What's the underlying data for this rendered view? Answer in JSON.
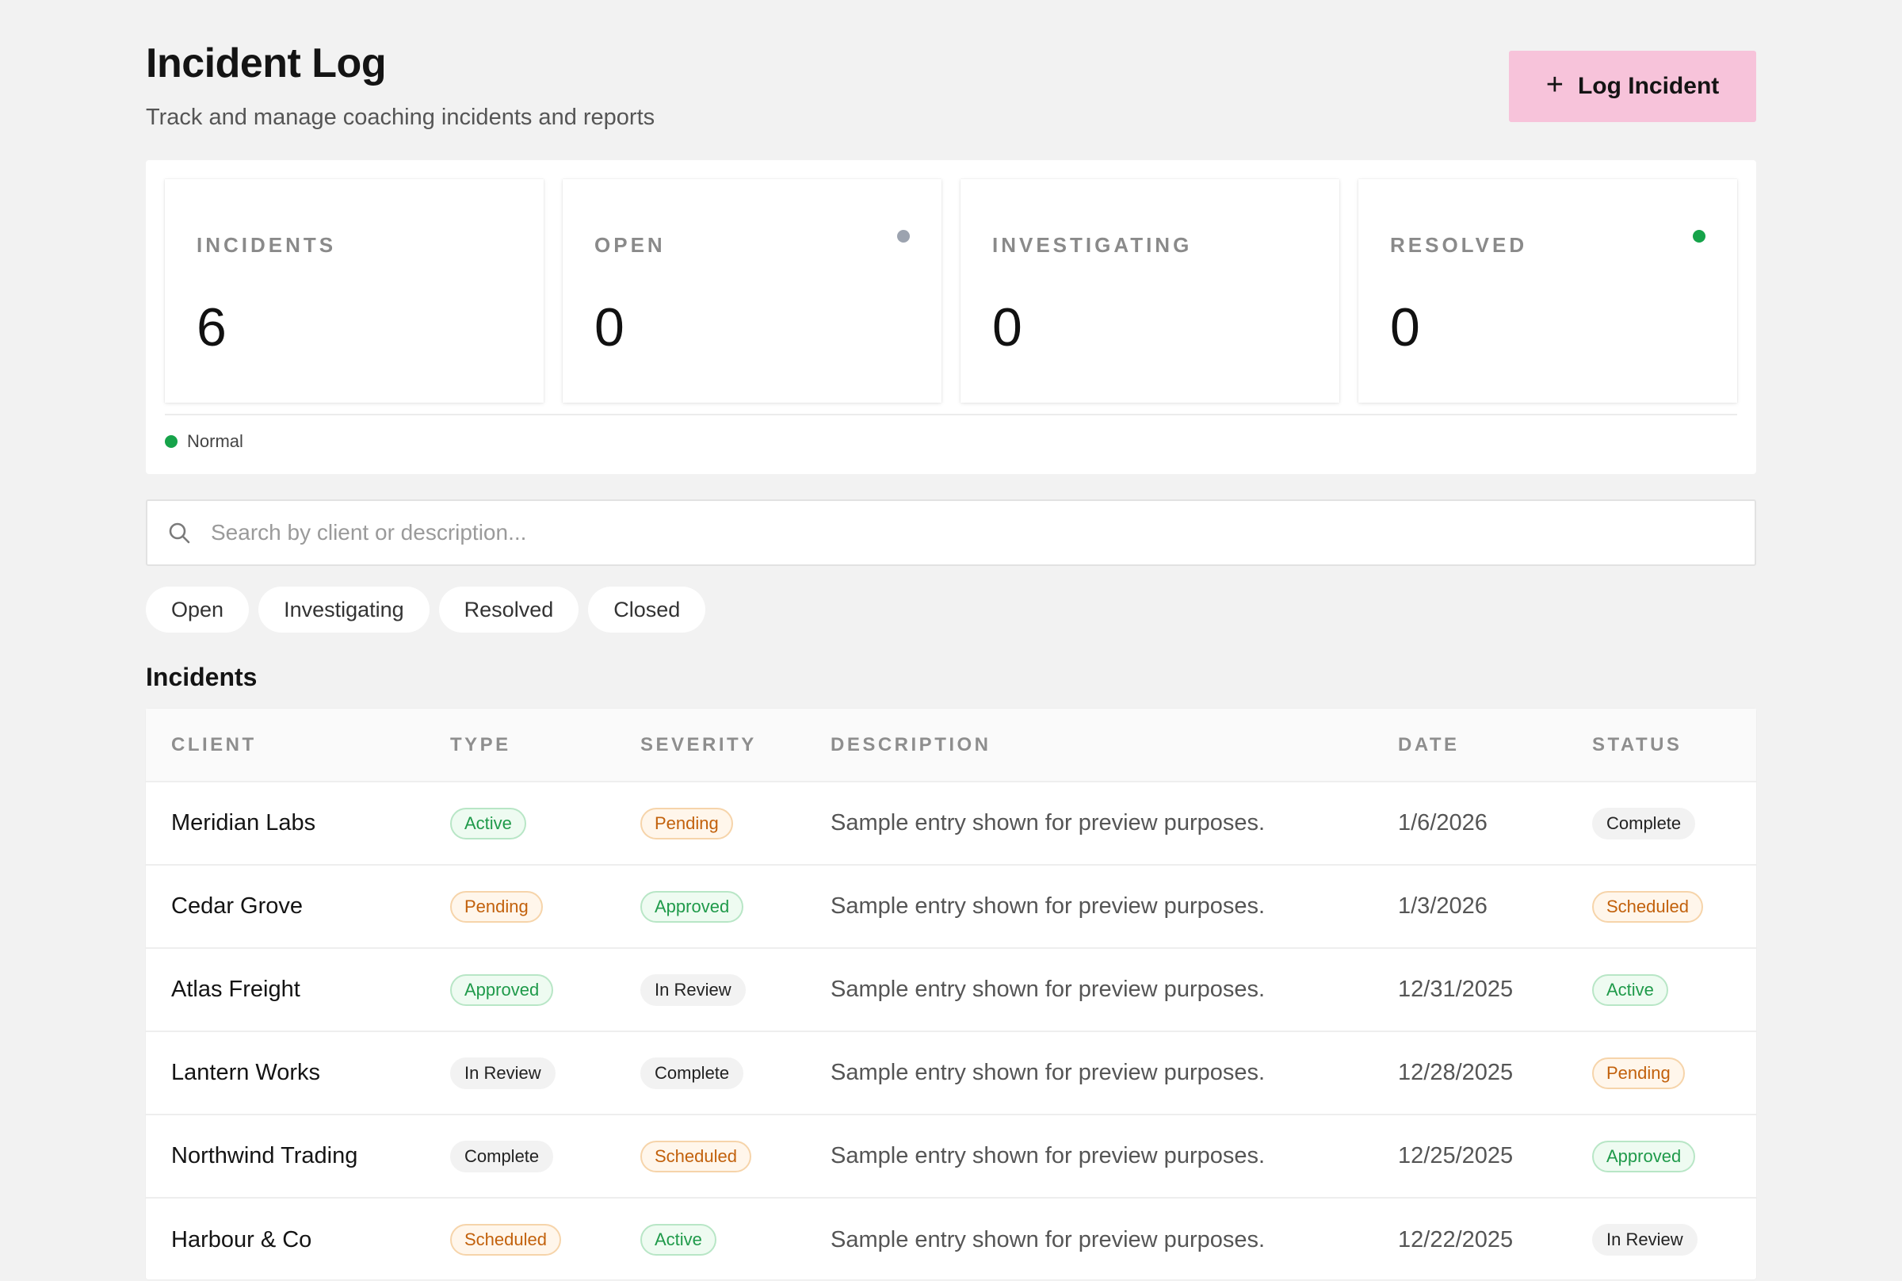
{
  "header": {
    "title": "Incident Log",
    "subtitle": "Track and manage coaching incidents and reports",
    "log_button_label": "Log Incident",
    "log_button_icon": "plus-icon"
  },
  "stats": [
    {
      "label": "INCIDENTS",
      "value": "6"
    },
    {
      "label": "OPEN",
      "value": "0",
      "dot_color": "#9ca3af"
    },
    {
      "label": "INVESTIGATING",
      "value": "0"
    },
    {
      "label": "RESOLVED",
      "value": "0",
      "dot_color": "#16a34a"
    }
  ],
  "status_indicator": {
    "label": "Normal",
    "color": "#16a34a"
  },
  "search": {
    "placeholder": "Search by client or description...",
    "value": ""
  },
  "filters": [
    "Open",
    "Investigating",
    "Resolved",
    "Closed"
  ],
  "section_title": "Incidents",
  "table": {
    "columns": [
      "CLIENT",
      "TYPE",
      "SEVERITY",
      "DESCRIPTION",
      "DATE",
      "STATUS"
    ],
    "rows": [
      {
        "client": "Meridian Labs",
        "type": "Active",
        "severity": "Pending",
        "description": "Sample entry shown for preview purposes.",
        "date": "1/6/2026",
        "status": "Complete"
      },
      {
        "client": "Cedar Grove",
        "type": "Pending",
        "severity": "Approved",
        "description": "Sample entry shown for preview purposes.",
        "date": "1/3/2026",
        "status": "Scheduled"
      },
      {
        "client": "Atlas Freight",
        "type": "Approved",
        "severity": "In Review",
        "description": "Sample entry shown for preview purposes.",
        "date": "12/31/2025",
        "status": "Active"
      },
      {
        "client": "Lantern Works",
        "type": "In Review",
        "severity": "Complete",
        "description": "Sample entry shown for preview purposes.",
        "date": "12/28/2025",
        "status": "Pending"
      },
      {
        "client": "Northwind Trading",
        "type": "Complete",
        "severity": "Scheduled",
        "description": "Sample entry shown for preview purposes.",
        "date": "12/25/2025",
        "status": "Approved"
      },
      {
        "client": "Harbour & Co",
        "type": "Scheduled",
        "severity": "Active",
        "description": "Sample entry shown for preview purposes.",
        "date": "12/22/2025",
        "status": "In Review"
      }
    ]
  },
  "colors": {
    "accent_button": "#f7c3da",
    "success": "#16a34a",
    "neutral_dot": "#9ca3af",
    "background": "#f2f2f2"
  }
}
